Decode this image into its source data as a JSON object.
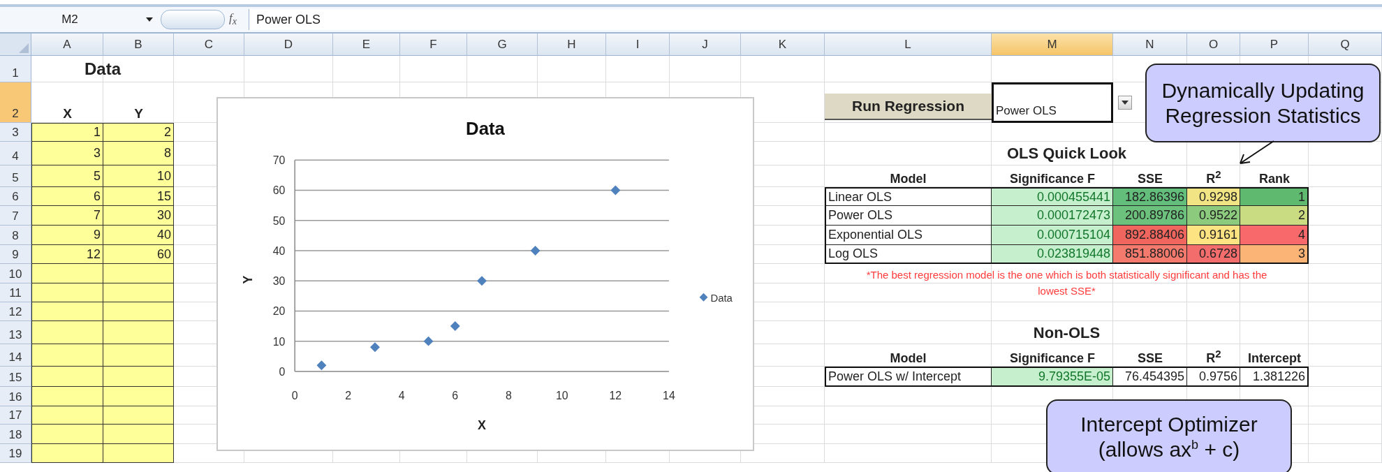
{
  "formula_bar": {
    "name_box": "M2",
    "function_label": "f$_{x}$",
    "formula": "Power OLS"
  },
  "column_headers": [
    {
      "label": "A",
      "selected": false
    },
    {
      "label": "B",
      "selected": false
    },
    {
      "label": "C",
      "selected": false
    },
    {
      "label": "D",
      "selected": false
    },
    {
      "label": "E",
      "selected": false
    },
    {
      "label": "F",
      "selected": false
    },
    {
      "label": "G",
      "selected": false
    },
    {
      "label": "H",
      "selected": false
    },
    {
      "label": "I",
      "selected": false
    },
    {
      "label": "J",
      "selected": false
    },
    {
      "label": "K",
      "selected": false
    },
    {
      "label": "L",
      "selected": false
    },
    {
      "label": "M",
      "selected": true
    },
    {
      "label": "N",
      "selected": false
    },
    {
      "label": "O",
      "selected": false
    },
    {
      "label": "P",
      "selected": false
    },
    {
      "label": "Q",
      "selected": false
    }
  ],
  "row_headers": [
    {
      "label": "1",
      "selected": false
    },
    {
      "label": "2",
      "selected": true
    },
    {
      "label": "3",
      "selected": false
    },
    {
      "label": "4",
      "selected": false
    },
    {
      "label": "5",
      "selected": false
    },
    {
      "label": "6",
      "selected": false
    },
    {
      "label": "7",
      "selected": false
    },
    {
      "label": "8",
      "selected": false
    },
    {
      "label": "9",
      "selected": false
    },
    {
      "label": "10",
      "selected": false
    },
    {
      "label": "11",
      "selected": false
    },
    {
      "label": "12",
      "selected": false
    },
    {
      "label": "13",
      "selected": false
    },
    {
      "label": "14",
      "selected": false
    },
    {
      "label": "15",
      "selected": false
    },
    {
      "label": "16",
      "selected": false
    },
    {
      "label": "17",
      "selected": false
    },
    {
      "label": "18",
      "selected": false
    },
    {
      "label": "19",
      "selected": false
    }
  ],
  "data_table": {
    "title": "Data",
    "columns": [
      "X",
      "Y"
    ],
    "rows": [
      [
        "1",
        "2"
      ],
      [
        "3",
        "8"
      ],
      [
        "5",
        "10"
      ],
      [
        "6",
        "15"
      ],
      [
        "7",
        "30"
      ],
      [
        "9",
        "40"
      ],
      [
        "12",
        "60"
      ]
    ]
  },
  "chart": {
    "chart_data": {
      "type": "scatter",
      "title": "Data",
      "xlabel": "X",
      "ylabel": "Y",
      "x": [
        1,
        3,
        5,
        6,
        7,
        9,
        12
      ],
      "series": [
        {
          "name": "Data",
          "color": "#4f81bd",
          "values": [
            2,
            8,
            10,
            15,
            30,
            40,
            60
          ]
        }
      ],
      "xlim": [
        0,
        14
      ],
      "ylim": [
        0,
        70
      ],
      "xticks": [
        0,
        2,
        4,
        6,
        8,
        10,
        12,
        14
      ],
      "yticks": [
        0,
        10,
        20,
        30,
        40,
        50,
        60,
        70
      ],
      "grid": true
    }
  },
  "run_regression": {
    "label": "Run Regression",
    "value": "Power OLS",
    "active": true
  },
  "ols_quick_look": {
    "title": "OLS Quick Look",
    "columns": [
      "Model",
      "Significance F",
      "SSE",
      "R$^{2}$",
      "Rank"
    ],
    "rows": [
      {
        "cells": [
          {
            "text": "Linear OLS"
          },
          {
            "text": "0.000455441",
            "color": "#c6efce"
          },
          {
            "text": "182.86396",
            "color": "#63be7b"
          },
          {
            "text": "0.9298",
            "color": "#f1e484"
          },
          {
            "text": "1",
            "color": "#5fba6f"
          }
        ]
      },
      {
        "cells": [
          {
            "text": "Power OLS"
          },
          {
            "text": "0.000172473",
            "color": "#c6efce"
          },
          {
            "text": "200.89786",
            "color": "#6cc17c"
          },
          {
            "text": "0.9522",
            "color": "#8ccb7e"
          },
          {
            "text": "2",
            "color": "#c9dc81"
          }
        ]
      },
      {
        "cells": [
          {
            "text": "Exponential OLS"
          },
          {
            "text": "0.000715104",
            "color": "#c6efce"
          },
          {
            "text": "892.88406",
            "color": "#f0665f"
          },
          {
            "text": "0.9161",
            "color": "#fee382"
          },
          {
            "text": "4",
            "color": "#f8696b"
          }
        ]
      },
      {
        "cells": [
          {
            "text": "Log OLS"
          },
          {
            "text": "0.023819448",
            "color": "#c6efce"
          },
          {
            "text": "851.88006",
            "color": "#f37a6c"
          },
          {
            "text": "0.6728",
            "color": "#f26d6b"
          },
          {
            "text": "3",
            "color": "#fbb376"
          }
        ]
      }
    ]
  },
  "note": "*The best regression model is the one which is both statistically significant and has the lowest SSE*",
  "non_ols": {
    "title": "Non-OLS",
    "columns": [
      "Model",
      "Significance F",
      "SSE",
      "R$^{2}$",
      "Intercept"
    ],
    "rows": [
      {
        "cells": [
          {
            "text": "Power OLS w/ Intercept"
          },
          {
            "text": "9.79355E-05",
            "color": "#c6efce"
          },
          {
            "text": "76.454395"
          },
          {
            "text": "0.9756"
          },
          {
            "text": "1.381226"
          }
        ]
      }
    ]
  },
  "callouts": [
    {
      "kind": "arrow",
      "lines": [
        "Dynamically Updating",
        "Regression Statistics"
      ]
    },
    {
      "kind": "plain",
      "lines": [
        "Intercept Optimizer",
        "(allows ax$^{b}$ + c)"
      ]
    }
  ]
}
